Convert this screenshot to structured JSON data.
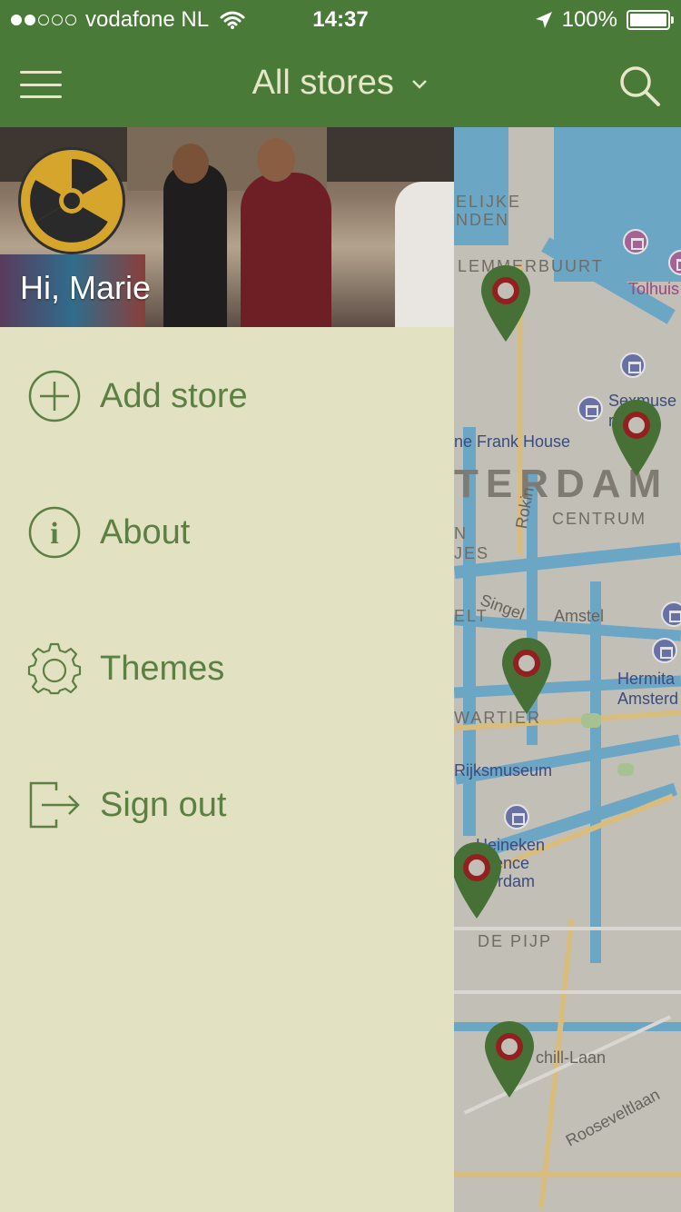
{
  "status_bar": {
    "carrier": "vodafone NL",
    "time": "14:37",
    "battery": "100%",
    "signal_bars_filled": 2,
    "signal_bars_total": 5
  },
  "nav": {
    "title": "All stores",
    "menu_icon": "hamburger-icon",
    "search_icon": "search-icon",
    "dropdown_icon": "chevron-down-icon"
  },
  "drawer": {
    "greeting": "Hi, Marie",
    "avatar_icon": "radiation-icon",
    "items": [
      {
        "label": "Add store",
        "icon": "add-circle-icon"
      },
      {
        "label": "About",
        "icon": "info-icon"
      },
      {
        "label": "Themes",
        "icon": "gear-icon"
      },
      {
        "label": "Sign out",
        "icon": "sign-out-icon"
      }
    ]
  },
  "map": {
    "labels": {
      "elijke_nden": "ELIJKE\nNDEN",
      "lemmerbuurt": "LEMMERBUURT",
      "tolhuis": "Tolhuis",
      "sexmuseum": "Sexmuse\nrd",
      "frank_house": "ne Frank House",
      "terdam": "TERDAM",
      "centrum": "CENTRUM",
      "rokin": "Rokin",
      "n_jes": "N\nJES",
      "singel": "Singel",
      "amstel": "Amstel",
      "elt": "ELT",
      "hermitage": "Hermita\nAmsterd",
      "wartier": "WARTIER",
      "rijksmuseum": "Rijksmuseum",
      "heineken": "Heineken\nerience\nsterdam",
      "de_pijp": "DE PIJP",
      "chill_laan": "chill-Laan",
      "rooseveltlaan": "Rooseveltlaan"
    },
    "accent_color": "#4a7a37",
    "pin_inner_color": "#a11d1d"
  }
}
